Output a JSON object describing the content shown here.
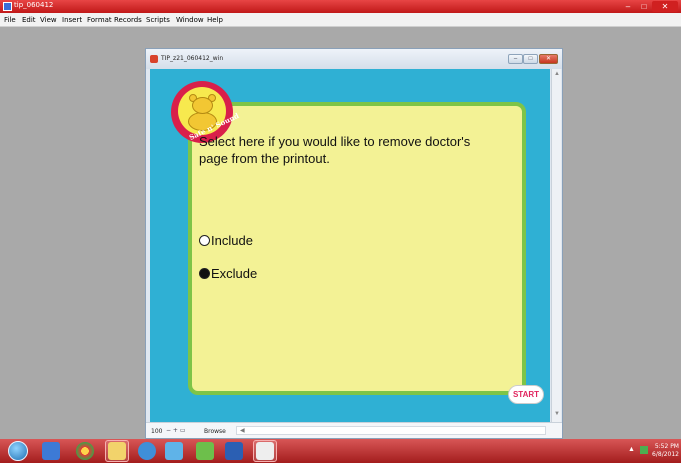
{
  "app": {
    "title": "tip_060412",
    "menu": [
      "File",
      "Edit",
      "View",
      "Insert",
      "Format",
      "Records",
      "Scripts",
      "Window",
      "Help"
    ]
  },
  "doc_window": {
    "title": "TIP_z21_060412_win"
  },
  "content": {
    "logo_text": "Safe n' Sound",
    "question": "Select here if you would like to remove doctor's page from the printout.",
    "options": [
      {
        "label": "Include",
        "checked": false
      },
      {
        "label": "Exclude",
        "checked": true
      }
    ],
    "start_label": "START"
  },
  "status": {
    "zoom": "100",
    "mode": "Browse"
  },
  "clock": {
    "time": "5:52 PM",
    "date": "6/8/2012"
  },
  "colors": {
    "background": "#2fb0d4",
    "panel": "#f3f295",
    "panel_border": "#7ec447",
    "start_text": "#e0245e"
  }
}
